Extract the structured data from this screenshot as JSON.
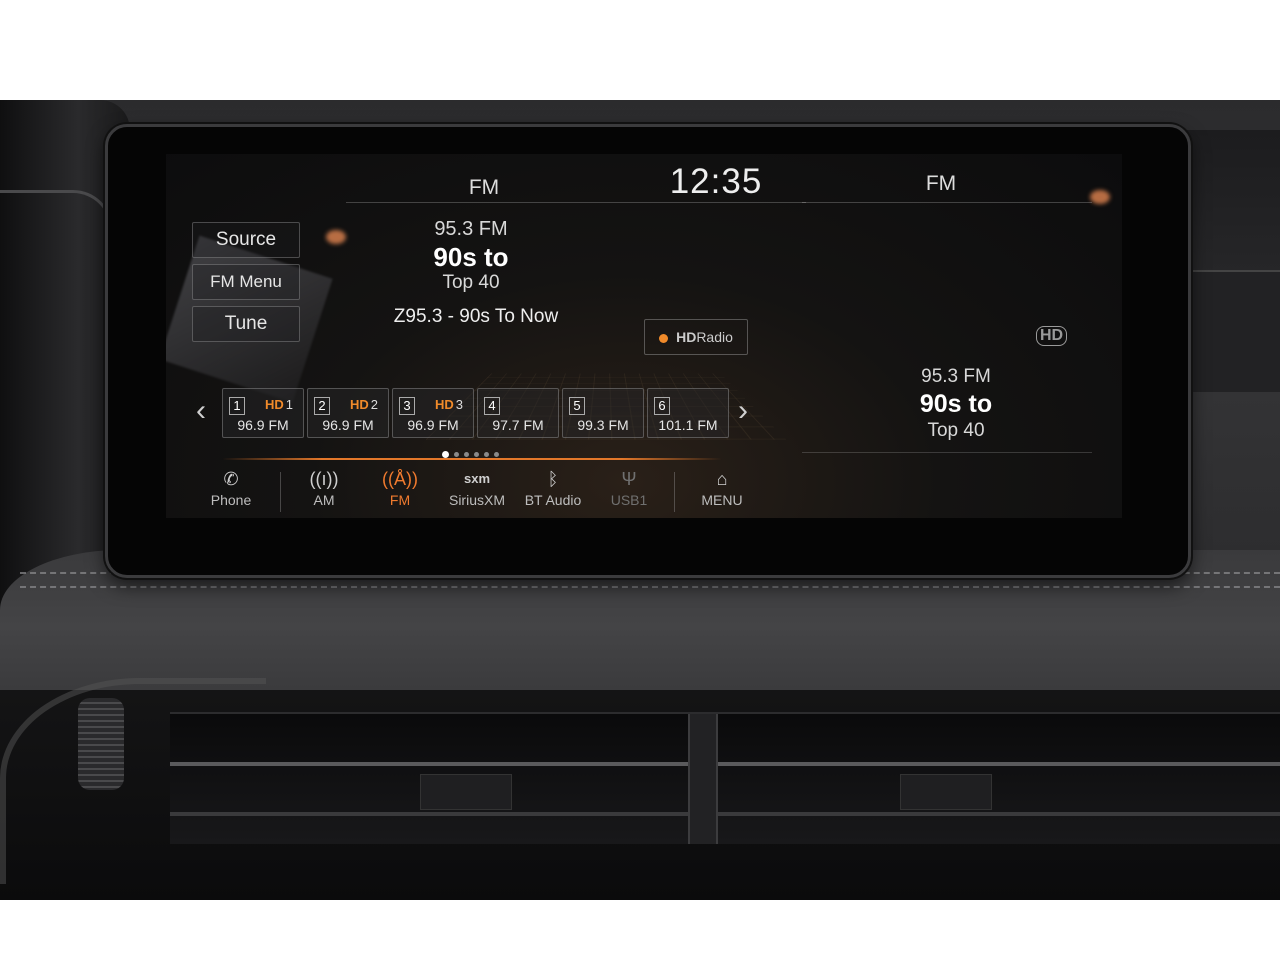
{
  "header": {
    "source_left": "FM",
    "clock": "12:35",
    "source_right": "FM"
  },
  "side_menu": {
    "source": "Source",
    "fm_menu": "FM Menu",
    "tune": "Tune"
  },
  "now_playing": {
    "frequency": "95.3  FM",
    "name_line1": "90s to",
    "name_line2": "Top 40",
    "title": "Z95.3 - 90s To Now"
  },
  "hd_radio_button": {
    "label": "Radio",
    "hd_mark": "HD",
    "indicator_color": "#f08a2a"
  },
  "presets": [
    {
      "num": "1",
      "hd": "1",
      "freq": "96.9  FM"
    },
    {
      "num": "2",
      "hd": "2",
      "freq": "96.9  FM"
    },
    {
      "num": "3",
      "hd": "3",
      "freq": "96.9  FM"
    },
    {
      "num": "4",
      "hd": "",
      "freq": "97.7  FM"
    },
    {
      "num": "5",
      "hd": "",
      "freq": "99.3  FM"
    },
    {
      "num": "6",
      "hd": "",
      "freq": "101.1  FM"
    }
  ],
  "preset_page_indicator": {
    "pages": 6,
    "active": 1
  },
  "source_bar": [
    {
      "label": "Phone",
      "icon": "phone-icon"
    },
    {
      "label": "AM",
      "icon": "antenna-icon"
    },
    {
      "label": "FM",
      "icon": "antenna-active-icon",
      "active": true
    },
    {
      "label": "SiriusXM",
      "icon": "sxm-icon",
      "icon_text": "sxm"
    },
    {
      "label": "BT Audio",
      "icon": "bluetooth-icon"
    },
    {
      "label": "USB1",
      "icon": "usb-icon",
      "disabled": true
    },
    {
      "label": "MENU",
      "icon": "home-icon"
    }
  ],
  "right_panel": {
    "hd_mark": "HD",
    "frequency": "95.3  FM",
    "name_line1": "90s to",
    "name_line2": "Top 40"
  },
  "colors": {
    "accent": "#f07a2e",
    "screen_bg": "#0c0c0d",
    "text": "#e8e8e8"
  }
}
